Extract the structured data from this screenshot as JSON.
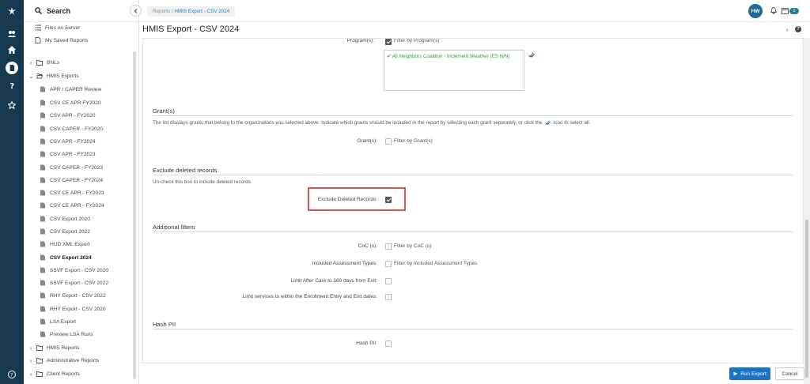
{
  "breadcrumb": {
    "root": "Reports",
    "separator": " / ",
    "current": "HMIS Export - CSV 2024"
  },
  "user": {
    "initials": "HW",
    "calendar_badge": "2"
  },
  "page": {
    "title": "HMIS Export - CSV 2024"
  },
  "sidebar": {
    "search_label": "Search",
    "items": [
      {
        "label": "Files on Server",
        "icon": "list-icon"
      },
      {
        "label": "My Saved Reports",
        "icon": "document-icon"
      },
      {
        "label": "BNLs",
        "icon": "folder-icon"
      },
      {
        "label": "HMIS Exports",
        "icon": "folder-open-icon"
      },
      {
        "label": "APR / CAPER Review",
        "icon": "report-icon"
      },
      {
        "label": "CSV CE APR FY2020",
        "icon": "report-icon"
      },
      {
        "label": "CSV APR - FY2020",
        "icon": "report-icon"
      },
      {
        "label": "CSV CAPER - FY2020",
        "icon": "report-icon"
      },
      {
        "label": "CSV APR - FY2024",
        "icon": "report-icon"
      },
      {
        "label": "CSV APR - FY2023",
        "icon": "report-icon"
      },
      {
        "label": "CSV CAPER - FY2023",
        "icon": "report-icon"
      },
      {
        "label": "CSV CAPER - FY2024",
        "icon": "report-icon"
      },
      {
        "label": "CSV CE APR - FY2023",
        "icon": "report-icon"
      },
      {
        "label": "CSV CE APR - FY2024",
        "icon": "report-icon"
      },
      {
        "label": "CSV Export 2020",
        "icon": "report-icon"
      },
      {
        "label": "CSV Export 2022",
        "icon": "report-icon"
      },
      {
        "label": "HUD XML Export",
        "icon": "report-icon"
      },
      {
        "label": "CSV Export 2024",
        "icon": "report-icon"
      },
      {
        "label": "SSVF Export - CSV 2020",
        "icon": "report-icon"
      },
      {
        "label": "SSVF Export - CSV 2022",
        "icon": "report-icon"
      },
      {
        "label": "RHY Export - CSV 2022",
        "icon": "report-icon"
      },
      {
        "label": "RHY Export - CSV 2020",
        "icon": "report-icon"
      },
      {
        "label": "LSA Export",
        "icon": "report-icon"
      },
      {
        "label": "Preview LSA Runs",
        "icon": "report-icon"
      },
      {
        "label": "HMIS Reports",
        "icon": "folder-icon"
      },
      {
        "label": "Administrative Reports",
        "icon": "folder-icon"
      },
      {
        "label": "Client Reports",
        "icon": "folder-icon"
      }
    ]
  },
  "form": {
    "programs": {
      "label": "Program(s):",
      "filter_label": "Filter by Program(s)",
      "selected": "All Neighbors Coalition - Inclement Weather (ES N/N)"
    },
    "grants": {
      "section_title": "Grant(s)",
      "description": "The list displays grants that belong to the organizations you selected above. Indicate which grants should be included in the report by selecting each grant separately, or click the",
      "description_tail": "icon to select all.",
      "label": "Grant(s):",
      "filter_label": "Filter by Grant(s)"
    },
    "deleted": {
      "section_title": "Exclude deleted records",
      "description": "Un-check this box to include deleted records.",
      "label": "Exclude Deleted Records:",
      "checked": true
    },
    "additional": {
      "section_title": "Additional filters",
      "coc_label": "CoC (s):",
      "coc_filter": "Filter by CoC (s)",
      "assess_label": "Included Assessment Types:",
      "assess_filter": "Filter by Included Assessment Types",
      "aftercare_label": "Limit After Care to 180 days from Exit:",
      "services_label": "Limit services to within the Enrollment Entry and Exit dates:"
    },
    "hash": {
      "section_title": "Hash PII",
      "label": "Hash PII:"
    }
  },
  "actions": {
    "run_label": "Run Export",
    "cancel_label": "Cancel"
  },
  "colors": {
    "rail": "#16394f",
    "primary": "#1a73c7",
    "success_text": "#2a9d4b",
    "highlight": "#d9534f"
  }
}
